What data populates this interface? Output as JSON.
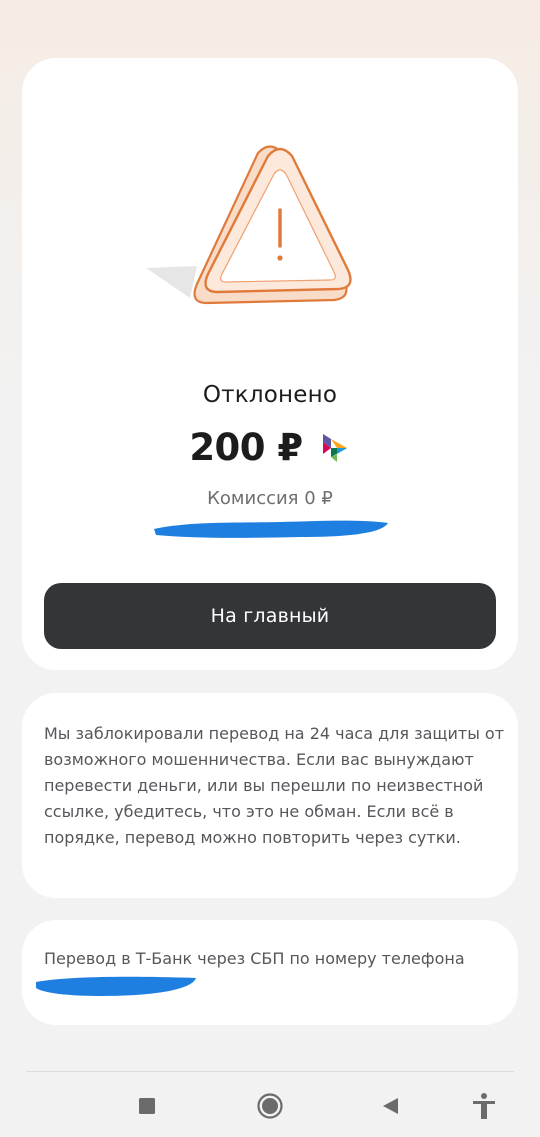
{
  "status": {
    "title": "Отклонено",
    "amount": "200 ₽",
    "commission": "Комиссия 0 ₽"
  },
  "actions": {
    "home_label": "На главный"
  },
  "info": {
    "text": "Мы заблокировали перевод на 24 часа для защиты от возможного мошенничества. Если вас вынуждают перевести деньги, или вы перешли по неизвестной ссылке, убедитесь, что это не обман. Если всё в порядке, перевод можно повторить через сутки."
  },
  "details": {
    "transfer_type": "Перевод в Т-Банк через СБП по номеру телефона"
  },
  "icons": {
    "warning": "warning-triangle-icon",
    "payment_system": "sbp-logo-icon",
    "nav": [
      "recents-square-icon",
      "home-circle-icon",
      "back-triangle-icon",
      "accessibility-icon"
    ]
  },
  "colors": {
    "warning_stroke": "#e07a3a",
    "warning_fill": "#fde6d6",
    "button_bg": "#333539",
    "scribble": "#1f7fe0"
  }
}
